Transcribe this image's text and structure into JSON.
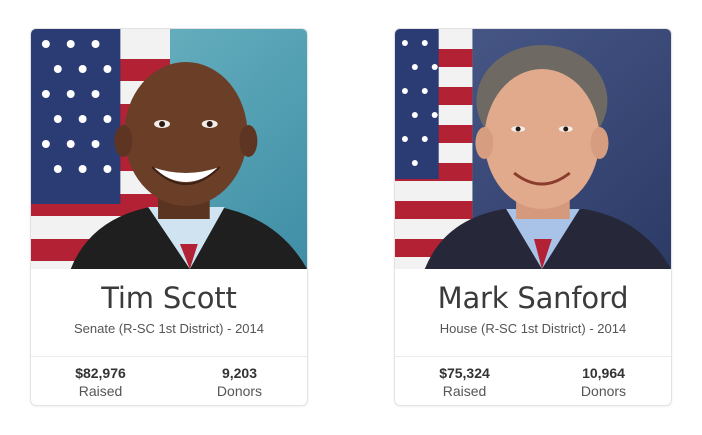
{
  "cards": [
    {
      "name": "Tim Scott",
      "subtitle": "Senate (R-SC 1st District) - 2014",
      "raised_value": "$82,976",
      "raised_label": "Raised",
      "donors_value": "9,203",
      "donors_label": "Donors",
      "photo": "portrait-photo"
    },
    {
      "name": "Mark Sanford",
      "subtitle": "House (R-SC 1st District) - 2014",
      "raised_value": "$75,324",
      "raised_label": "Raised",
      "donors_value": "10,964",
      "donors_label": "Donors",
      "photo": "portrait-photo"
    }
  ],
  "colors": {
    "card_border": "#e3e3e3",
    "name_text": "#3b3b3b",
    "muted_text": "#555555",
    "flag_red": "#b22234",
    "flag_blue": "#2b3b73"
  }
}
